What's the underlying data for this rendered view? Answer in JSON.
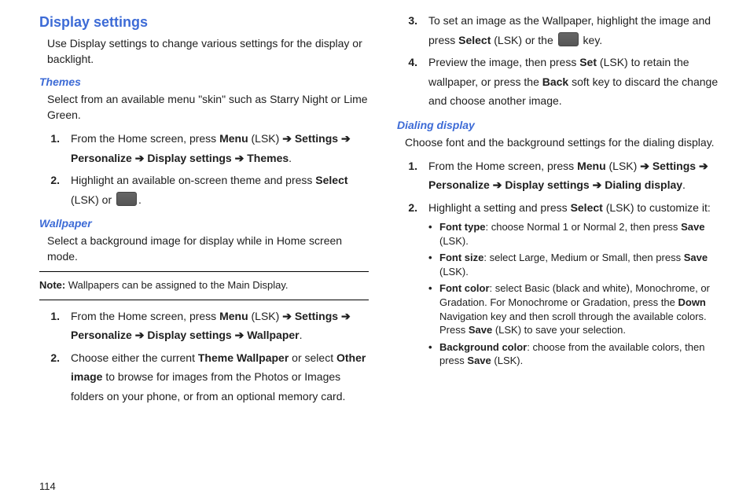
{
  "page_number": "114",
  "arrow": "➔",
  "left": {
    "h1": "Display settings",
    "intro": "Use Display settings to change various settings for the display or backlight.",
    "themes": {
      "heading": "Themes",
      "intro": "Select from an available menu \"skin\" such as Starry Night or Lime Green.",
      "steps": {
        "s1": {
          "num": "1.",
          "pre": "From the Home screen, press ",
          "menu": "Menu",
          "lsk": " (LSK) ",
          "settings": "Settings",
          "personalize": "Personalize",
          "display": "Display settings",
          "themes": "Themes",
          "period": "."
        },
        "s2": {
          "num": "2.",
          "pre": "Highlight an available on-screen theme and press ",
          "select": "Select",
          "mid": " (LSK) or ",
          "post": "."
        }
      }
    },
    "wallpaper": {
      "heading": "Wallpaper",
      "intro": "Select a background image for display while in Home screen mode.",
      "note_label": "Note:",
      "note_body": " Wallpapers can be assigned to the Main Display.",
      "steps": {
        "s1": {
          "num": "1.",
          "pre": "From the Home screen, press ",
          "menu": "Menu",
          "lsk": " (LSK) ",
          "settings": "Settings",
          "personalize": "Personalize",
          "display": "Display settings",
          "wallpaper": "Wallpaper",
          "period": "."
        },
        "s2": {
          "num": "2.",
          "pre": "Choose either the current ",
          "tw": "Theme Wallpaper",
          "mid": " or select ",
          "oi": "Other image",
          "post": " to browse for images from the Photos or Images folders on your phone, or from an optional memory card."
        }
      }
    }
  },
  "right": {
    "cont": {
      "s3": {
        "num": "3.",
        "pre": "To set an image as the Wallpaper, highlight the image and press ",
        "select": "Select",
        "mid": " (LSK) or the ",
        "post": " key."
      },
      "s4": {
        "num": "4.",
        "pre": "Preview the image, then press ",
        "set": "Set",
        "mid": " (LSK) to retain the wallpaper, or press the ",
        "back": "Back",
        "post": " soft key to discard the change and choose another image."
      }
    },
    "dialing": {
      "heading": "Dialing display",
      "intro": "Choose font and the background settings for the dialing display.",
      "steps": {
        "s1": {
          "num": "1.",
          "pre": "From the Home screen, press ",
          "menu": "Menu",
          "lsk": " (LSK) ",
          "settings": "Settings",
          "personalize": "Personalize",
          "display": "Display settings",
          "dialing": "Dialing display",
          "period": "."
        },
        "s2": {
          "num": "2.",
          "pre": "Highlight a setting and press ",
          "select": "Select",
          "post": " (LSK) to customize it:"
        }
      },
      "bullets": {
        "b1": {
          "label": "Font type",
          "body": ": choose Normal 1 or Normal 2, then press ",
          "save": "Save",
          "post": " (LSK)."
        },
        "b2": {
          "label": "Font size",
          "body": ": select Large, Medium or Small, then press ",
          "save": "Save",
          "post": " (LSK)."
        },
        "b3": {
          "label": "Font color",
          "body": ": select Basic (black and white), Monochrome, or Gradation. For Monochrome or Gradation, press the ",
          "down": "Down",
          "body2": " Navigation key and then scroll through the available colors. Press ",
          "save": "Save",
          "post": " (LSK) to save your selection."
        },
        "b4": {
          "label": "Background color",
          "body": ": choose from the available colors, then press ",
          "save": "Save",
          "post": " (LSK)."
        }
      }
    }
  }
}
